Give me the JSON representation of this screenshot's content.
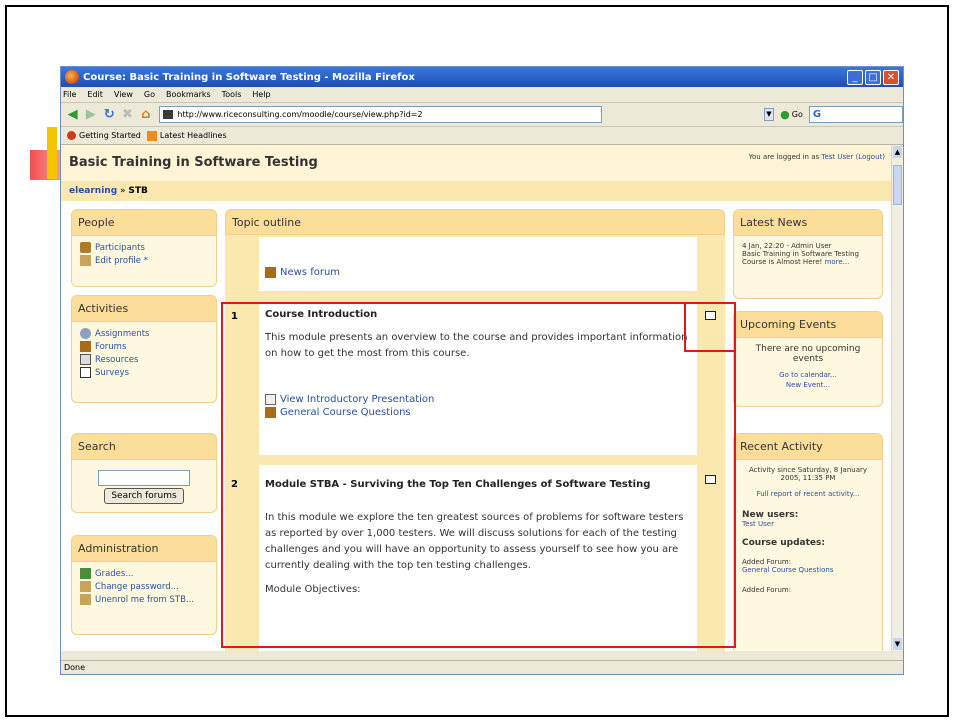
{
  "window": {
    "title": "Course: Basic Training in Software Testing - Mozilla Firefox",
    "controls": [
      "_",
      "□",
      "✕"
    ]
  },
  "menu": [
    "File",
    "Edit",
    "View",
    "Go",
    "Bookmarks",
    "Tools",
    "Help"
  ],
  "nav": {
    "url": "http://www.riceconsulting.com/moodle/course/view.php?id=2",
    "go_label": "Go",
    "search_value": "G"
  },
  "bookmarks": {
    "item1": "Getting Started",
    "item2": "Latest Headlines"
  },
  "page": {
    "title": "Basic Training in Software Testing",
    "login_prefix": "You are logged in as",
    "login_user": "Test User",
    "logout": "(Logout)",
    "breadcrumb_home": "elearning",
    "breadcrumb_sep": "»",
    "breadcrumb_current": "STB"
  },
  "people": {
    "title": "People",
    "participants": "Participants",
    "edit_profile": "Edit profile",
    "edit_star": "*"
  },
  "activities": {
    "title": "Activities",
    "assignments": "Assignments",
    "forums": "Forums",
    "resources": "Resources",
    "surveys": "Surveys"
  },
  "search": {
    "title": "Search",
    "button": "Search forums",
    "value": ""
  },
  "admin": {
    "title": "Administration",
    "grades": "Grades...",
    "change_password": "Change password...",
    "unenrol": "Unenrol me from STB..."
  },
  "topic": {
    "title": "Topic outline",
    "news_forum": "News forum",
    "sections": [
      {
        "num": "1",
        "title": "Course Introduction",
        "text": "This module presents an overview to the course and provides important information on how to get the most from this course.",
        "link1": "View Introductory Presentation",
        "link2": "General Course Questions"
      },
      {
        "num": "2",
        "title": "Module STBA - Surviving the Top Ten Challenges of Software Testing",
        "text": "In this module we explore the ten greatest sources of problems for software testers as reported by over 1,000 testers. We will discuss solutions for each of the testing challenges and you will have an opportunity to assess yourself to see how you are currently dealing with the top ten testing challenges.",
        "objectives": "Module Objectives:"
      }
    ]
  },
  "news": {
    "title": "Latest News",
    "meta": "4 Jan, 22:20 - Admin User",
    "text": "Basic Training in Software Testing Course is Almost Here!",
    "more": "more..."
  },
  "events": {
    "title": "Upcoming Events",
    "text": "There are no upcoming events",
    "calendar": "Go to calendar...",
    "new_event": "New Event..."
  },
  "activity": {
    "title": "Recent Activity",
    "since": "Activity since Saturday, 8 January 2005, 11:35 PM",
    "full_report": "Full report of recent activity...",
    "new_users": "New users:",
    "user": "Test User",
    "updates": "Course updates:",
    "added1": "Added Forum:",
    "added1_link": "General Course Questions",
    "added2": "Added Forum:"
  },
  "status": "Done"
}
